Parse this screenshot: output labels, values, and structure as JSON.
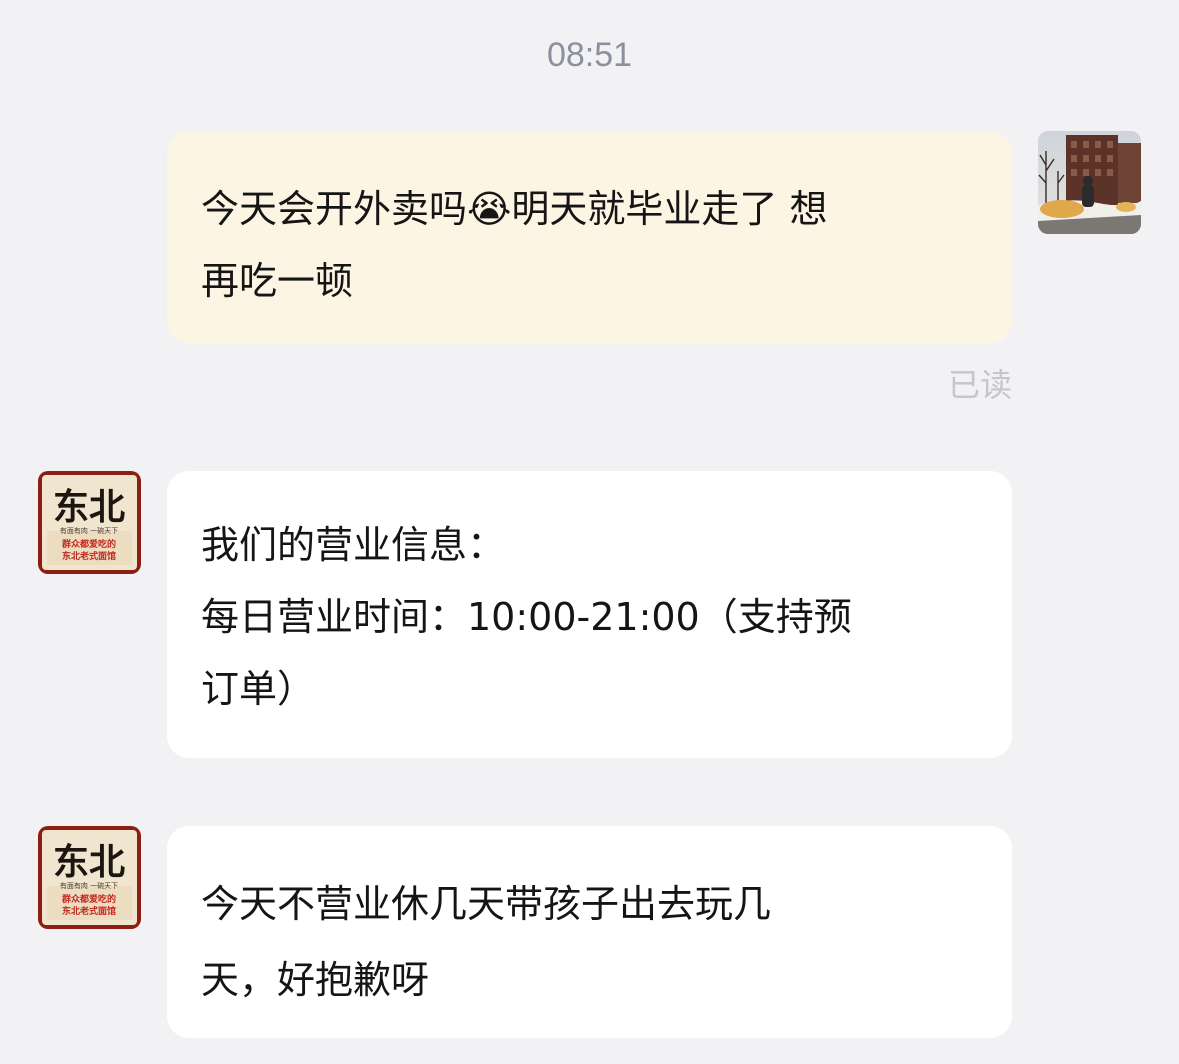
{
  "header": {
    "timestamp": "08:51"
  },
  "messages": [
    {
      "sender": "user",
      "text": "今天会开外卖吗😭明天就毕业走了 想\n再吃一顿",
      "status": "已读"
    },
    {
      "sender": "shop",
      "text": "我们的营业信息：\n每日营业时间：10:00-21:00（支持预\n订单）"
    },
    {
      "sender": "shop",
      "text": "今天不营业休几天带孩子出去玩几\n天，好抱歉呀"
    }
  ],
  "avatars": {
    "user": {
      "icon": "photo-avatar"
    },
    "shop": {
      "icon": "shop-logo-avatar",
      "logo_title": "东北",
      "logo_line_1": "有面有肉 一碗天下",
      "logo_line_2": "群众都爱吃的",
      "logo_line_3": "东北老式面馆"
    }
  },
  "colors": {
    "background": "#f2f2f4",
    "outgoing_bubble": "#fdf5e4",
    "incoming_bubble": "#ffffff",
    "timestamp": "#8b919c",
    "read_receipt": "#c4c6cc",
    "logo_red": "#c2281e"
  }
}
